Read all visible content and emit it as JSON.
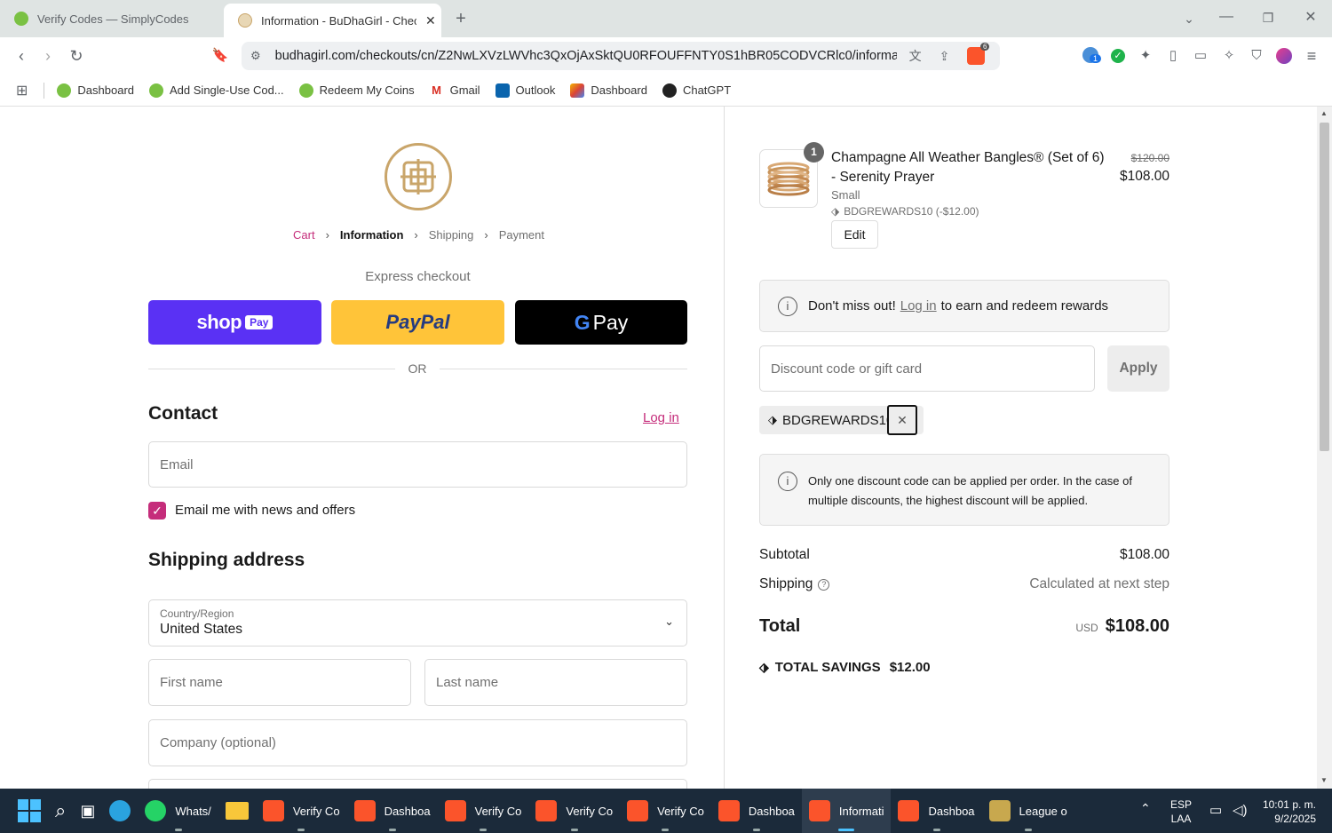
{
  "browser": {
    "tabs": [
      {
        "title": "Verify Codes — SimplyCodes",
        "active": false
      },
      {
        "title": "Information - BuDhaGirl - Chec",
        "active": true
      }
    ],
    "url": "budhagirl.com/checkouts/cn/Z2NwLXVzLWVhc3QxOjAxSktQU0RFOUFFNTY0S1hBR05CODVCRlc0/informati...",
    "extension_badge": "1",
    "shield_badge": "6",
    "bookmarks": [
      {
        "label": "Dashboard",
        "icon": "simplycodes-icon"
      },
      {
        "label": "Add Single-Use Cod...",
        "icon": "simplycodes-icon"
      },
      {
        "label": "Redeem My Coins",
        "icon": "simplycodes-icon"
      },
      {
        "label": "Gmail",
        "icon": "gmail-icon"
      },
      {
        "label": "Outlook",
        "icon": "outlook-icon"
      },
      {
        "label": "Dashboard",
        "icon": "dashboard-icon"
      },
      {
        "label": "ChatGPT",
        "icon": "chatgpt-icon"
      }
    ]
  },
  "checkout": {
    "breadcrumb": {
      "cart": "Cart",
      "information": "Information",
      "shipping": "Shipping",
      "payment": "Payment"
    },
    "express_title": "Express checkout",
    "express_buttons": {
      "shop": "shop",
      "shop_pay": "Pay",
      "paypal": "PayPal",
      "gpay": "Pay"
    },
    "or": "OR",
    "contact_title": "Contact",
    "login_link": "Log in",
    "email_placeholder": "Email",
    "newsletter_label": "Email me with news and offers",
    "newsletter_checked": true,
    "shipping_title": "Shipping address",
    "country_label": "Country/Region",
    "country_value": "United States",
    "first_name_placeholder": "First name",
    "last_name_placeholder": "Last name",
    "company_placeholder": "Company (optional)"
  },
  "summary": {
    "item": {
      "quantity": "1",
      "name_line1": "Champagne All Weather Bangles® (Set of 6)",
      "name_line2": "- Serenity Prayer",
      "variant": "Small",
      "discount": "BDGREWARDS10 (-$12.00)",
      "original_price": "$120.00",
      "price": "$108.00",
      "edit": "Edit"
    },
    "rewards": {
      "prefix": "Don't miss out!",
      "link": "Log in",
      "suffix": "to earn and redeem rewards"
    },
    "discount_placeholder": "Discount code or gift card",
    "apply": "Apply",
    "applied_code": "BDGREWARDS10",
    "notice": "Only one discount code can be applied per order. In the case of multiple discounts, the highest discount will be applied.",
    "subtotal_label": "Subtotal",
    "subtotal_value": "$108.00",
    "shipping_label": "Shipping",
    "shipping_value": "Calculated at next step",
    "total_label": "Total",
    "currency": "USD",
    "total_value": "$108.00",
    "savings_label": "TOTAL SAVINGS",
    "savings_value": "$12.00"
  },
  "taskbar": {
    "apps": [
      {
        "label": "Whats/",
        "color": "#25d366"
      },
      {
        "label": "Verify Co",
        "color": "#fb542b"
      },
      {
        "label": "Dashboa",
        "color": "#fb542b"
      },
      {
        "label": "Verify Co",
        "color": "#fb542b"
      },
      {
        "label": "Verify Co",
        "color": "#fb542b"
      },
      {
        "label": "Verify Co",
        "color": "#fb542b"
      },
      {
        "label": "Dashboa",
        "color": "#fb542b"
      },
      {
        "label": "Informati",
        "color": "#fb542b"
      },
      {
        "label": "Dashboa",
        "color": "#fb542b"
      },
      {
        "label": "League o",
        "color": "#c8a84e"
      }
    ],
    "lang1": "ESP",
    "lang2": "LAA",
    "time": "10:01 p. m.",
    "date": "9/2/2025"
  }
}
